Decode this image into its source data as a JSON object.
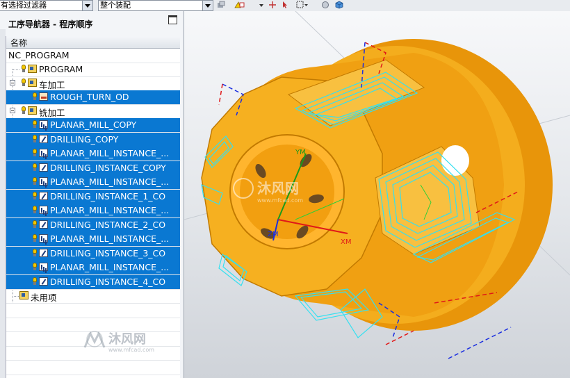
{
  "toolbar": {
    "filter_combo": "有选择过滤器",
    "assembly_combo": "整个装配"
  },
  "navigator": {
    "title": "工序导航器 - 程序顺序",
    "column_header": "名称",
    "rows": [
      {
        "label": "NC_PROGRAM",
        "type": "root",
        "selected": false
      },
      {
        "label": "PROGRAM",
        "type": "group",
        "selected": false
      },
      {
        "label": "车加工",
        "type": "group",
        "selected": false
      },
      {
        "label": "ROUGH_TURN_OD",
        "type": "turn",
        "selected": true
      },
      {
        "label": "铣加工",
        "type": "group",
        "selected": false
      },
      {
        "label": "PLANAR_MILL_COPY",
        "type": "mill",
        "selected": true
      },
      {
        "label": "DRILLING_COPY",
        "type": "drill",
        "selected": true
      },
      {
        "label": "PLANAR_MILL_INSTANCE_...",
        "type": "mill",
        "selected": true
      },
      {
        "label": "DRILLING_INSTANCE_COPY",
        "type": "drill",
        "selected": true
      },
      {
        "label": "PLANAR_MILL_INSTANCE_...",
        "type": "mill",
        "selected": true
      },
      {
        "label": "DRILLING_INSTANCE_1_CO",
        "type": "drill",
        "selected": true
      },
      {
        "label": "PLANAR_MILL_INSTANCE_...",
        "type": "mill",
        "selected": true
      },
      {
        "label": "DRILLING_INSTANCE_2_CO",
        "type": "drill",
        "selected": true
      },
      {
        "label": "PLANAR_MILL_INSTANCE_...",
        "type": "mill",
        "selected": true
      },
      {
        "label": "DRILLING_INSTANCE_3_CO",
        "type": "drill",
        "selected": true
      },
      {
        "label": "PLANAR_MILL_INSTANCE_...",
        "type": "mill",
        "selected": true
      },
      {
        "label": "DRILLING_INSTANCE_4_CO",
        "type": "drill",
        "selected": true
      },
      {
        "label": "未用项",
        "type": "group",
        "selected": false
      }
    ]
  },
  "viewport": {
    "axis_ym": "YM",
    "axis_xm": "XM",
    "axis_zm": "ZM"
  },
  "watermark": {
    "brand": "沐风网",
    "url": "www.mfcad.com"
  },
  "colors": {
    "selection": "#0a78d2",
    "part": "#f0a20a",
    "toolpath": "#35e0f0",
    "axis_red": "#e01818",
    "axis_blue": "#1a2ee0"
  }
}
